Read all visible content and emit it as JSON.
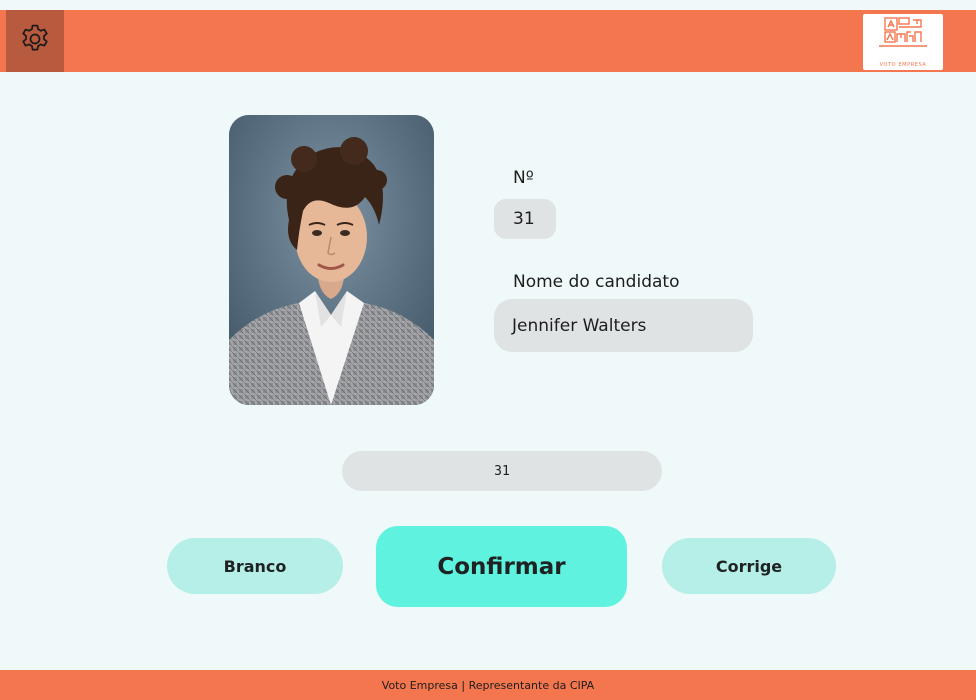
{
  "header": {
    "settings_icon": "gear-icon",
    "logo_text": "VOTO EMPRESA",
    "colors": {
      "bar": "#f4764f",
      "settings_bg": "#b85a3e"
    }
  },
  "candidate": {
    "number_label": "Nº",
    "number_value": "31",
    "name_label": "Nome do candidato",
    "name_value": "Jennifer Walters"
  },
  "input": {
    "typed_value": "31"
  },
  "actions": {
    "branco_label": "Branco",
    "confirmar_label": "Confirmar",
    "corrige_label": "Corrige",
    "colors": {
      "secondary": "#b6efe7",
      "primary": "#5ef2df"
    }
  },
  "footer": {
    "text": "Voto Empresa | Representante da CIPA"
  }
}
